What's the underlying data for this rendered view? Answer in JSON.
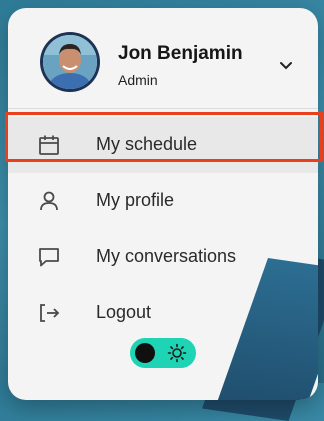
{
  "user": {
    "name": "Jon Benjamin",
    "role": "Admin"
  },
  "menu": {
    "items": [
      {
        "label": "My schedule",
        "icon": "calendar-icon"
      },
      {
        "label": "My profile",
        "icon": "user-icon"
      },
      {
        "label": "My conversations",
        "icon": "chat-bubble-icon"
      },
      {
        "label": "Logout",
        "icon": "logout-icon"
      }
    ],
    "selected_index": 0
  },
  "theme_toggle": {
    "mode": "dark",
    "icons": [
      "dark-mode-knob",
      "sun-icon"
    ]
  },
  "colors": {
    "card_background": "#f4f4f4",
    "highlight": "#e8401d",
    "toggle_accent": "#1ed4b4",
    "text_primary": "#161616",
    "icon_stroke": "#4a4a4a"
  }
}
